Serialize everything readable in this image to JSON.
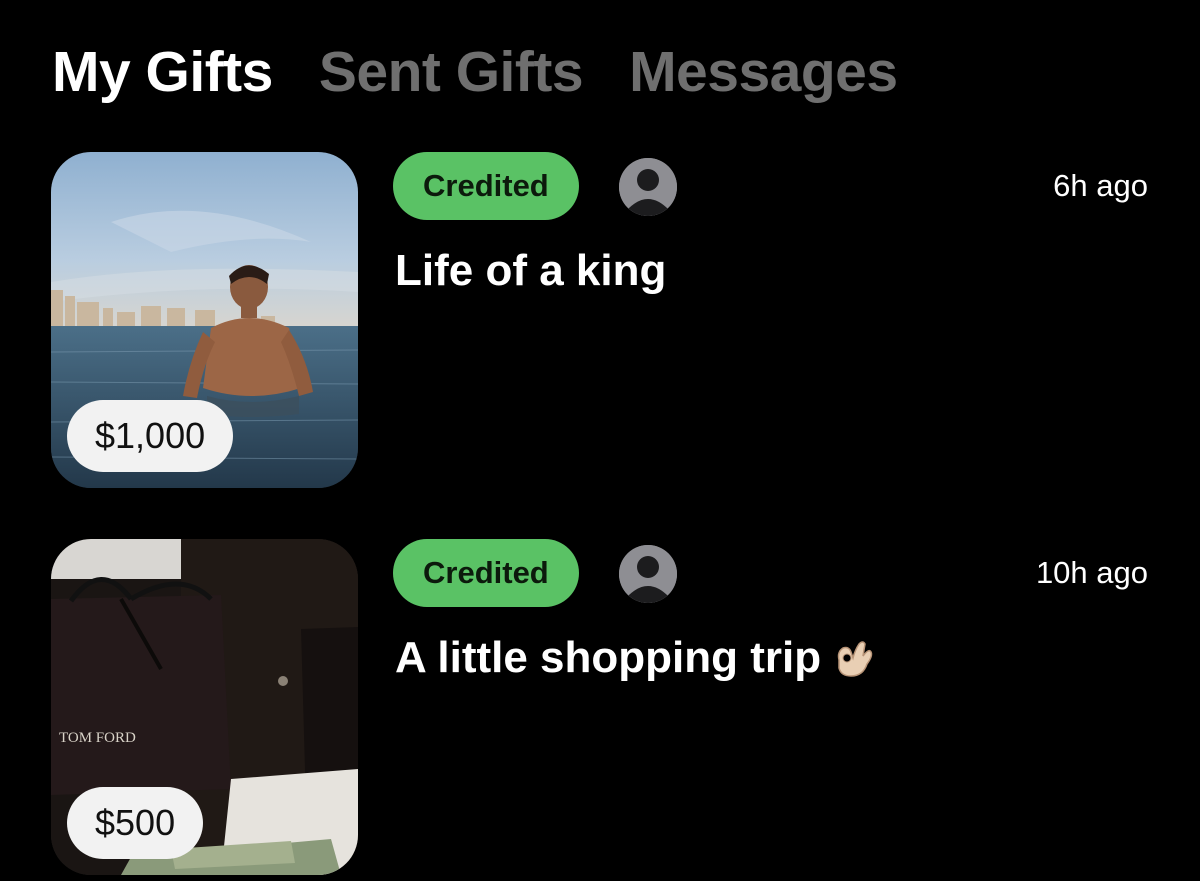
{
  "tabs": [
    {
      "label": "My Gifts",
      "active": true
    },
    {
      "label": "Sent Gifts",
      "active": false
    },
    {
      "label": "Messages",
      "active": false
    }
  ],
  "colors": {
    "background": "#000000",
    "active_tab": "#ffffff",
    "inactive_tab": "#6f6f6f",
    "credited_badge": "#5ac265",
    "amount_pill": "#f2f2f2"
  },
  "gifts": [
    {
      "status": "Credited",
      "time": "6h ago",
      "title": "Life of a king",
      "amount": "$1,000",
      "avatar_icon": "default-user-avatar-icon",
      "image_icon": "beach-photo"
    },
    {
      "status": "Credited",
      "time": "10h ago",
      "title": "A little shopping trip",
      "title_emoji": "ok-hand-emoji",
      "amount": "$500",
      "avatar_icon": "default-user-avatar-icon",
      "image_icon": "shopping-bags-photo",
      "image_text": "TOM FORD"
    }
  ]
}
